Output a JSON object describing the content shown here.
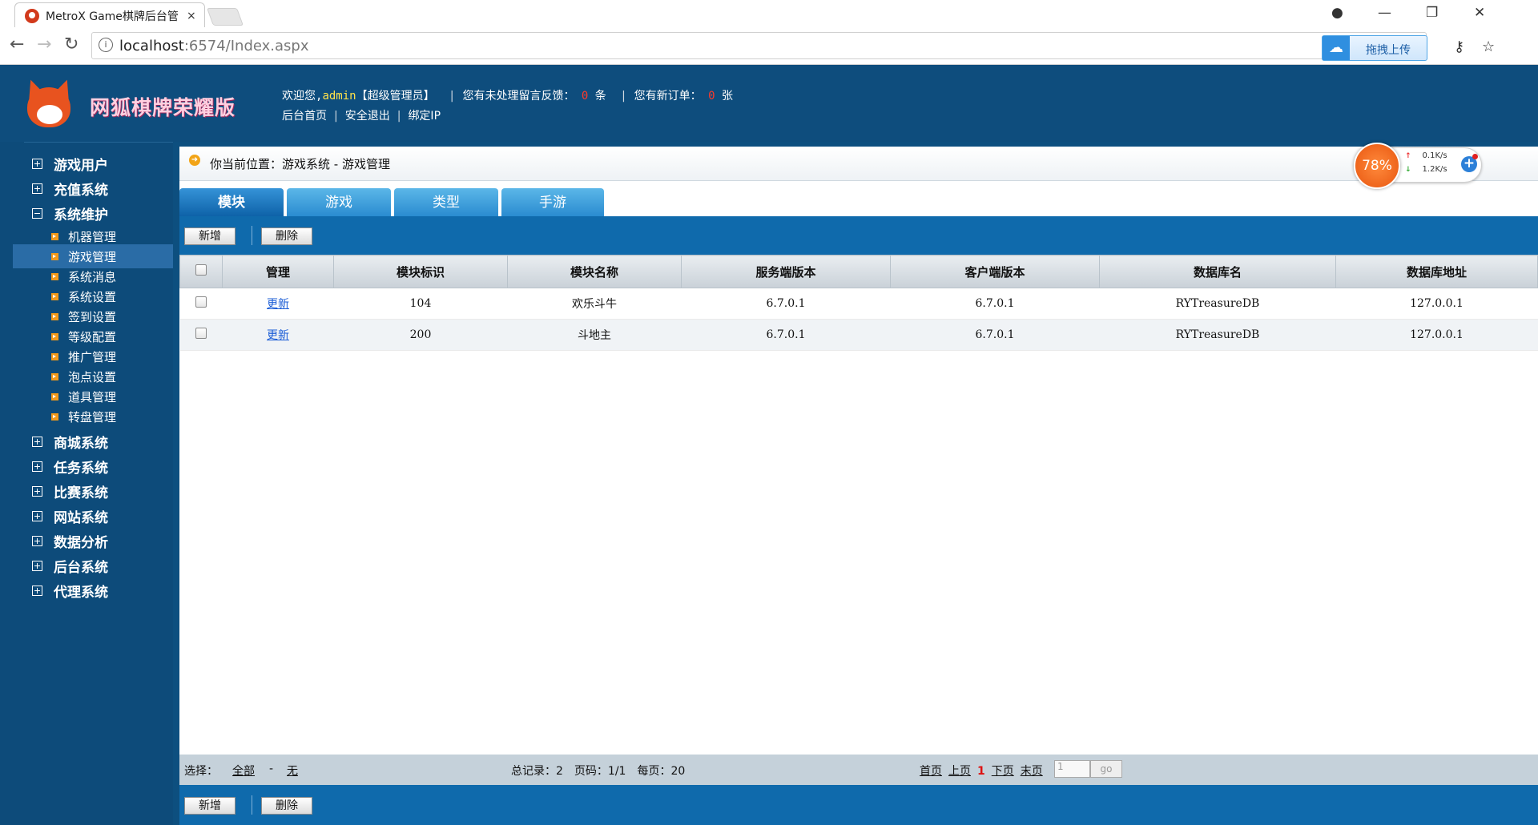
{
  "browser": {
    "tab_title": "MetroX Game棋牌后台管",
    "tab_close": "×",
    "url_host": "localhost",
    "url_rest": ":6574/Index.aspx",
    "upload_label": "拖拽上传",
    "window_min": "—",
    "window_restore": "❐",
    "window_close": "✕"
  },
  "header": {
    "brand": "网狐棋牌荣耀版",
    "welcome": "欢迎您,",
    "user": "admin",
    "role": "【超级管理员】",
    "pending_msg_prefix": "您有未处理留言反馈：",
    "pending_msg_count": "0",
    "pending_msg_unit": "条",
    "new_order_prefix": "您有新订单：",
    "new_order_count": "0",
    "new_order_unit": "张",
    "links": [
      "后台首页",
      "安全退出",
      "绑定IP"
    ]
  },
  "sidebar": {
    "top_items": [
      {
        "label": "游戏用户"
      },
      {
        "label": "充值系统"
      },
      {
        "label": "系统维护"
      }
    ],
    "sub_items": [
      {
        "label": "机器管理"
      },
      {
        "label": "游戏管理"
      },
      {
        "label": "系统消息"
      },
      {
        "label": "系统设置"
      },
      {
        "label": "签到设置"
      },
      {
        "label": "等级配置"
      },
      {
        "label": "推广管理"
      },
      {
        "label": "泡点设置"
      },
      {
        "label": "道具管理"
      },
      {
        "label": "转盘管理"
      }
    ],
    "bottom_items": [
      {
        "label": "商城系统"
      },
      {
        "label": "任务系统"
      },
      {
        "label": "比赛系统"
      },
      {
        "label": "网站系统"
      },
      {
        "label": "数据分析"
      },
      {
        "label": "后台系统"
      },
      {
        "label": "代理系统"
      }
    ],
    "active_sub": "游戏管理"
  },
  "content": {
    "breadcrumb": "你当前位置：游戏系统 - 游戏管理",
    "tabs": [
      "模块",
      "游戏",
      "类型",
      "手游"
    ],
    "add_label": "新增",
    "delete_label": "删除",
    "columns": [
      "管理",
      "模块标识",
      "模块名称",
      "服务端版本",
      "客户端版本",
      "数据库名",
      "数据库地址"
    ],
    "rows": [
      {
        "action": "更新",
        "id": "104",
        "name": "欢乐斗牛",
        "server_ver": "6.7.0.1",
        "client_ver": "6.7.0.1",
        "db_name": "RYTreasureDB",
        "db_addr": "127.0.0.1"
      },
      {
        "action": "更新",
        "id": "200",
        "name": "斗地主",
        "server_ver": "6.7.0.1",
        "client_ver": "6.7.0.1",
        "db_name": "RYTreasureDB",
        "db_addr": "127.0.0.1"
      }
    ],
    "footer": {
      "select_label": "选择：",
      "select_all": "全部",
      "dash": "-",
      "select_none": "无",
      "summary": "总记录：2　页码：1/1　每页：20",
      "first": "首页",
      "prev": "上页",
      "current": "1",
      "next": "下页",
      "last": "末页",
      "page_input": "1",
      "go": "go"
    }
  },
  "speed_widget": {
    "percent": "78%",
    "up": "0.1K/s",
    "down": "1.2K/s"
  },
  "colors": {
    "nav_bg": "#0d4f7f",
    "accent_blue": "#0f6aac",
    "orange": "#f39a1a"
  }
}
